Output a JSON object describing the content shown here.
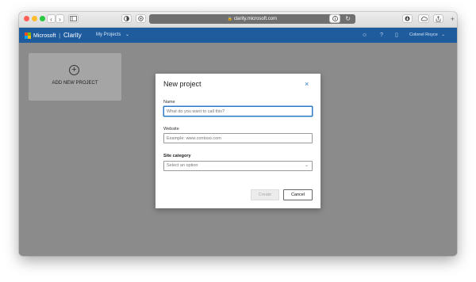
{
  "browser": {
    "url": "clarity.microsoft.com",
    "back_glyph": "‹",
    "forward_glyph": "›",
    "reload_glyph": "↻",
    "new_tab_glyph": "+"
  },
  "app": {
    "brand_company": "Microsoft",
    "brand_product": "Clarity",
    "nav_projects": "My Projects",
    "nav_chevron": "⌄",
    "user_name": "Colonel Royce",
    "user_chevron": "⌄",
    "smile_glyph": "☺",
    "help_glyph": "?",
    "doc_glyph": "▯"
  },
  "project_card": {
    "plus_glyph": "+",
    "label": "ADD NEW PROJECT"
  },
  "modal": {
    "title": "New project",
    "close_glyph": "×",
    "name_label": "Name",
    "name_placeholder": "What do you want to call this?",
    "website_label": "Website",
    "website_placeholder": "Example: www.contoso.com",
    "category_label": "Site category",
    "category_value": "Select an option",
    "category_chevron": "⌄",
    "create_label": "Create",
    "cancel_label": "Cancel"
  },
  "colors": {
    "header": "#1e5c9e",
    "accent": "#2a7ac8",
    "overlay": "#8b8b8b",
    "close_red": "#ff5f57",
    "minimize_yellow": "#febc2e",
    "zoom_green": "#28c840"
  },
  "icons": [
    "close-light",
    "minimize-light",
    "zoom-light",
    "sidebar-icon",
    "privacy-icon",
    "settings-icon",
    "info-icon",
    "download-icon",
    "cloud-icon",
    "share-icon",
    "microsoft-logo-icon",
    "smile-icon",
    "help-icon",
    "document-icon"
  ]
}
